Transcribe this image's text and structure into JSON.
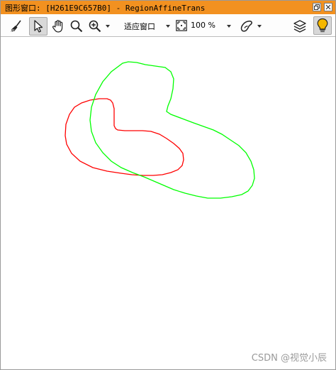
{
  "window": {
    "title": "图形窗口: [H261E9C657B0] - RegionAffineTrans"
  },
  "toolbar": {
    "zoom_mode_label": "适应窗口",
    "zoom_percent_label": "100 %"
  },
  "icons": {
    "clear": "brush-icon",
    "select": "pointer-icon",
    "pan": "hand-icon",
    "magnify": "magnifier-icon",
    "zoom": "zoom-in-icon",
    "fit": "fit-window-icon",
    "region": "region-shape-icon",
    "layers": "layers-icon",
    "feedback": "lightbulb-icon"
  },
  "regions": [
    {
      "name": "original-region",
      "color": "#ff0000"
    },
    {
      "name": "transformed-region",
      "color": "#00ff00"
    }
  ],
  "watermark": "CSDN @视觉小辰",
  "colors": {
    "titlebar": "#f29120",
    "bulb": "#f5b700"
  }
}
